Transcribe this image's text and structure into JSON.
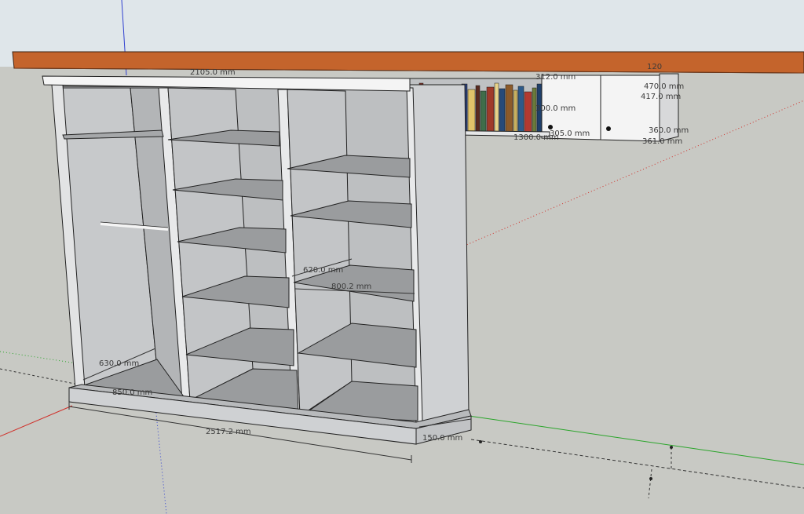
{
  "app": {
    "name": "SketchUp 3D model viewport"
  },
  "dimensions": {
    "top_width": "2105.0 mm",
    "shelf_depth": "620.0 mm",
    "section_width": "800.2 mm",
    "wardrobe_depth": "630.0 mm",
    "base_depth": "850.0 mm",
    "overall_width": "2517.2 mm",
    "plinth_height": "150.0 mm",
    "niche_depth": "305.0 mm",
    "niche_width": "1300.0 mm",
    "cabinet_height_a": "470.0 mm",
    "cabinet_height_b": "417.0 mm",
    "cabinet_depth": "360.0 mm",
    "cabinet_depth_b": "361.0 mm",
    "top_overhang": "120",
    "niche_height": "312.0 mm",
    "book_height": "300.0 mm"
  },
  "colors": {
    "background": "#c8c9c4",
    "sky": "#dfe6ea",
    "countertop": "#c4642c",
    "panel": "#d2d4d6",
    "panel_dark": "#a9abad",
    "axis_red": "#d0302a",
    "axis_green": "#2aa52a",
    "axis_blue": "#3040d0"
  },
  "books": [
    "#7a2a1e",
    "#4a6b8a",
    "#b54030",
    "#2f4a2a",
    "#d6b468",
    "#8a3a6a",
    "#c24a3a",
    "#2a3f7a",
    "#e0c36a",
    "#5a2a20",
    "#3f6d4a",
    "#a03a2a",
    "#e9d38a",
    "#264a7a",
    "#8c5a2a",
    "#c8b060",
    "#2d5a8a",
    "#b23a30",
    "#6a7a3a",
    "#1f3f6a"
  ]
}
